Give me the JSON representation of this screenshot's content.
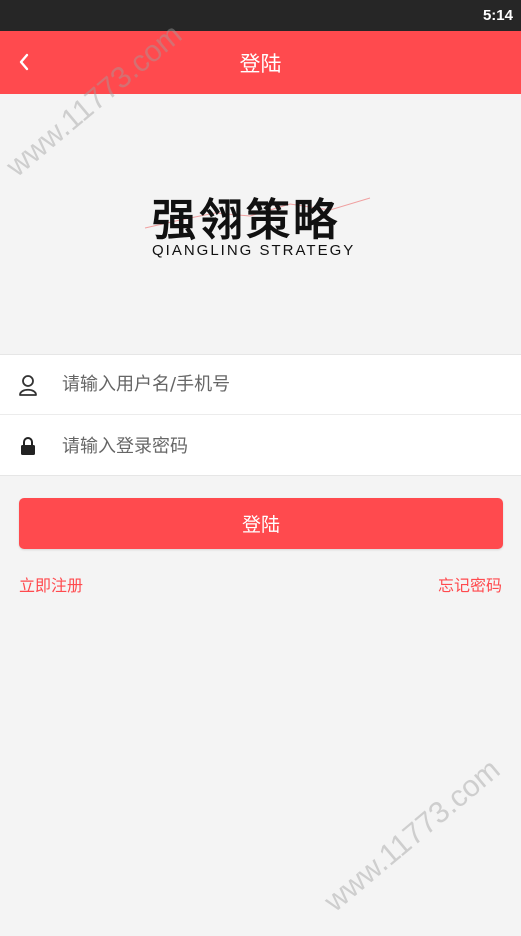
{
  "status_bar": {
    "time": "5:14"
  },
  "nav": {
    "title": "登陆",
    "back_icon": "chevron-left-icon"
  },
  "logo": {
    "chinese": "强翎策略",
    "english": "QIANGLING STRATEGY"
  },
  "form": {
    "username_placeholder": "请输入用户名/手机号",
    "username_icon": "user-icon",
    "password_placeholder": "请输入登录密码",
    "password_icon": "lock-icon"
  },
  "login_button": "登陆",
  "links": {
    "register": "立即注册",
    "forgot": "忘记密码"
  },
  "watermark": "www.11773.com",
  "colors": {
    "accent": "#ff4a4e",
    "status_bar": "#262626",
    "background": "#f4f4f4"
  }
}
